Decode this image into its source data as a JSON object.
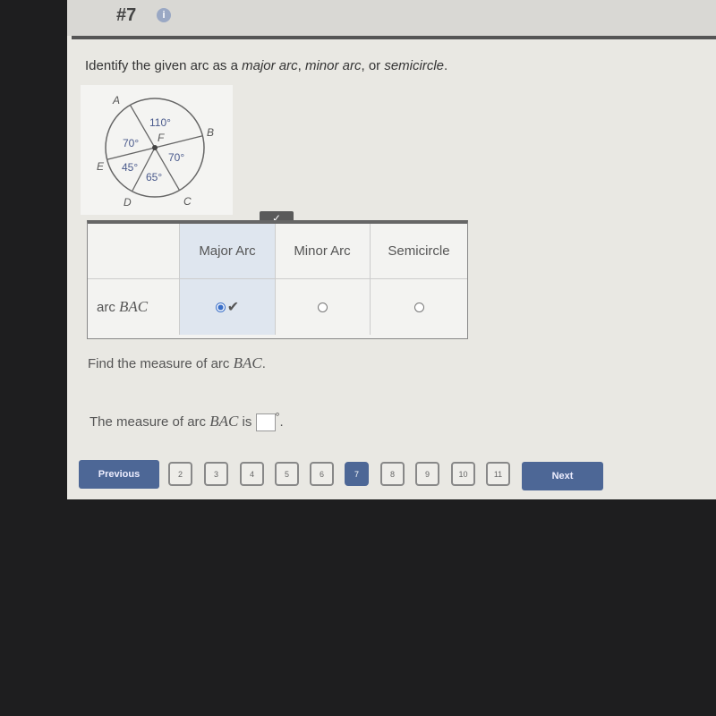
{
  "header": {
    "question": "#7",
    "info_icon": "info-icon"
  },
  "prompt": {
    "pre": "Identify the given arc as a ",
    "major": "major arc",
    "sep1": ", ",
    "minor": "minor arc",
    "sep2": ", or ",
    "semi": "semicircle",
    "end": "."
  },
  "figure": {
    "points": [
      "A",
      "B",
      "C",
      "D",
      "E",
      "F"
    ],
    "angles": [
      "110°",
      "70°",
      "70°",
      "45°",
      "65°"
    ]
  },
  "table": {
    "columns": [
      "Major Arc",
      "Minor Arc",
      "Semicircle"
    ],
    "row_label": "arc ",
    "row_arc": "BAC",
    "selected": "Major Arc",
    "correct_icon": "checkmark-icon",
    "tab_mark": "✓",
    "check": "✔"
  },
  "find": {
    "text": "Find the measure of arc ",
    "arc": "BAC",
    "end": "."
  },
  "answer": {
    "pre": "The measure of arc ",
    "arc": "BAC",
    "mid": " is ",
    "value": "",
    "unit": "°",
    "end": "."
  },
  "nav": {
    "previous": "Previous",
    "next": "Next",
    "pages": [
      "2",
      "3",
      "4",
      "5",
      "6",
      "7",
      "8",
      "9",
      "10",
      "11"
    ],
    "current": "7"
  },
  "colors": {
    "button": "#4d6796",
    "selected_cell": "#dfe6ef"
  }
}
